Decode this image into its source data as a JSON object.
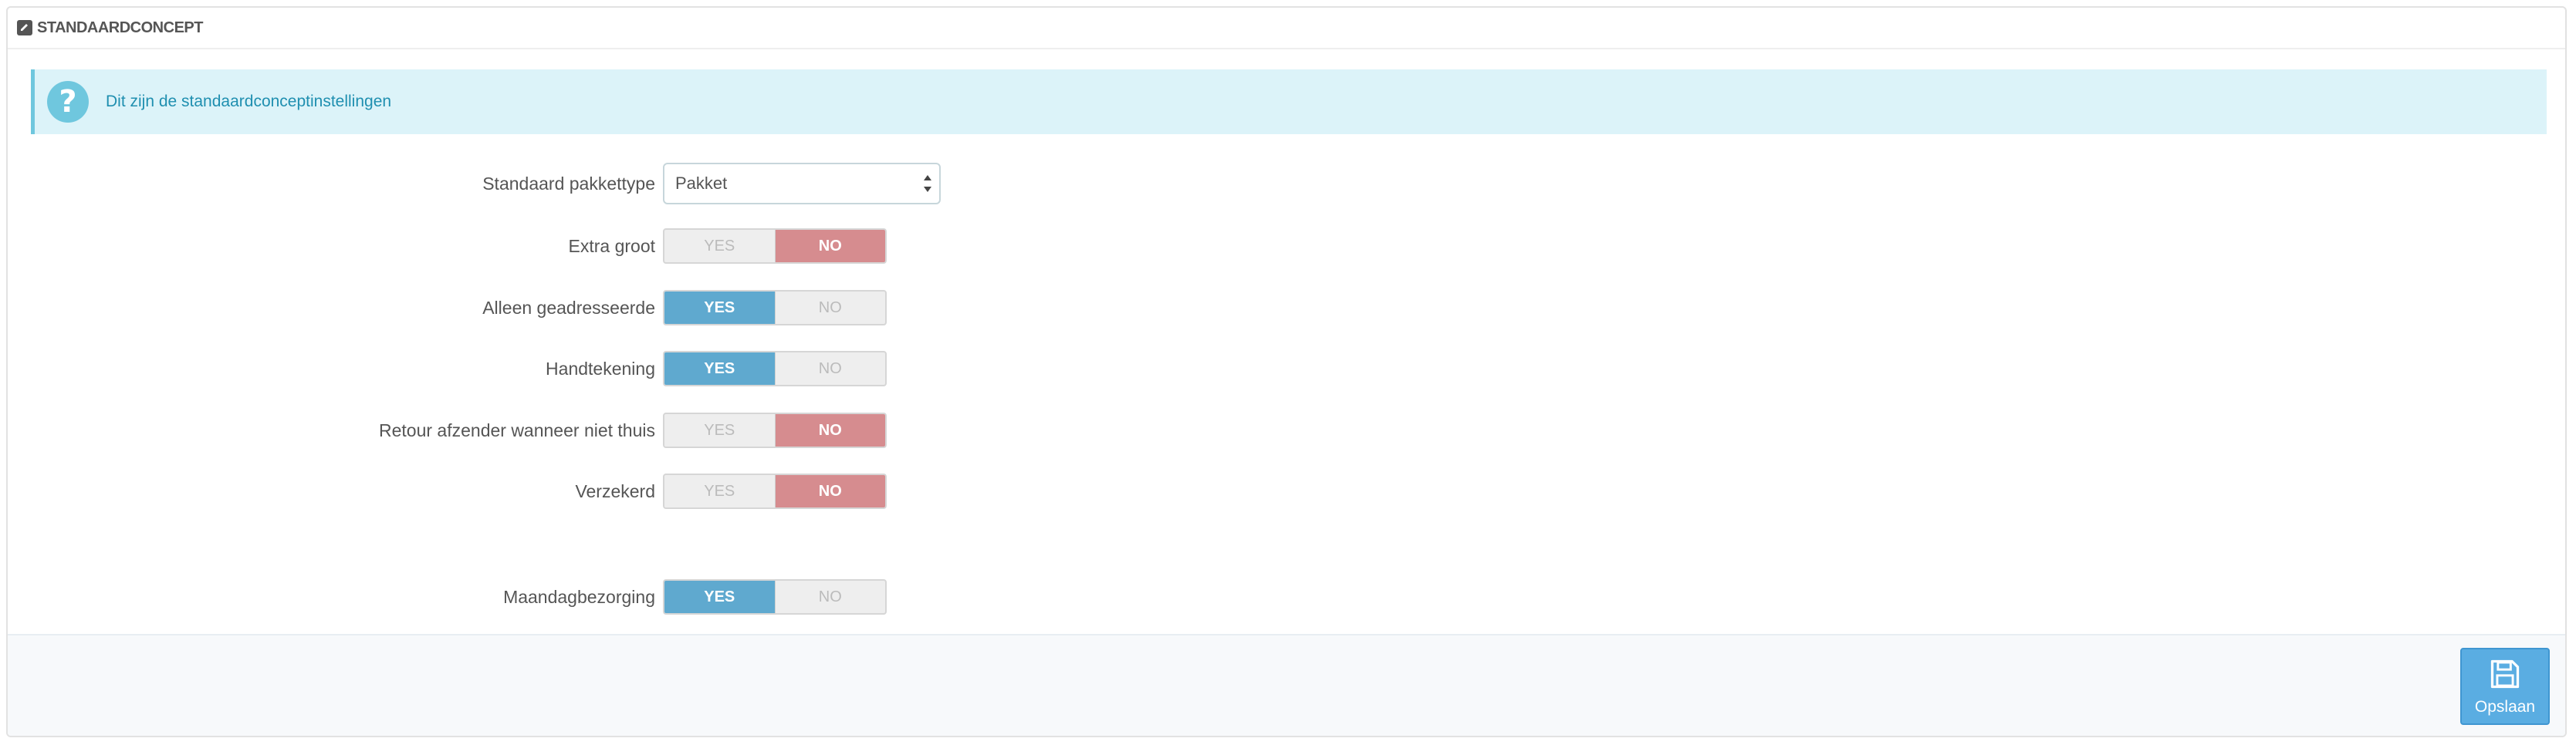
{
  "panel": {
    "title": "STANDAARDCONCEPT",
    "heading_icon": "edit-icon"
  },
  "alert": {
    "icon": "question-circle-icon",
    "text": "Dit zijn de standaardconceptinstellingen"
  },
  "form": {
    "package_type": {
      "label": "Standaard pakkettype",
      "value": "Pakket"
    },
    "toggles": [
      {
        "label": "Extra groot",
        "yes": "YES",
        "no": "NO",
        "value": "NO"
      },
      {
        "label": "Alleen geadresseerde",
        "yes": "YES",
        "no": "NO",
        "value": "YES"
      },
      {
        "label": "Handtekening",
        "yes": "YES",
        "no": "NO",
        "value": "YES"
      },
      {
        "label": "Retour afzender wanneer niet thuis",
        "yes": "YES",
        "no": "NO",
        "value": "NO"
      },
      {
        "label": "Verzekerd",
        "yes": "YES",
        "no": "NO",
        "value": "NO"
      },
      {
        "label": "Maandagbezorging",
        "yes": "YES",
        "no": "NO",
        "value": "YES"
      }
    ]
  },
  "footer": {
    "save_label": "Opslaan",
    "save_icon": "floppy-disk-icon"
  },
  "colors": {
    "yes_active": "#5fa9cf",
    "no_active": "#d68c8f",
    "alert_bg": "#dcf3f9",
    "save_button": "#5aade2"
  }
}
